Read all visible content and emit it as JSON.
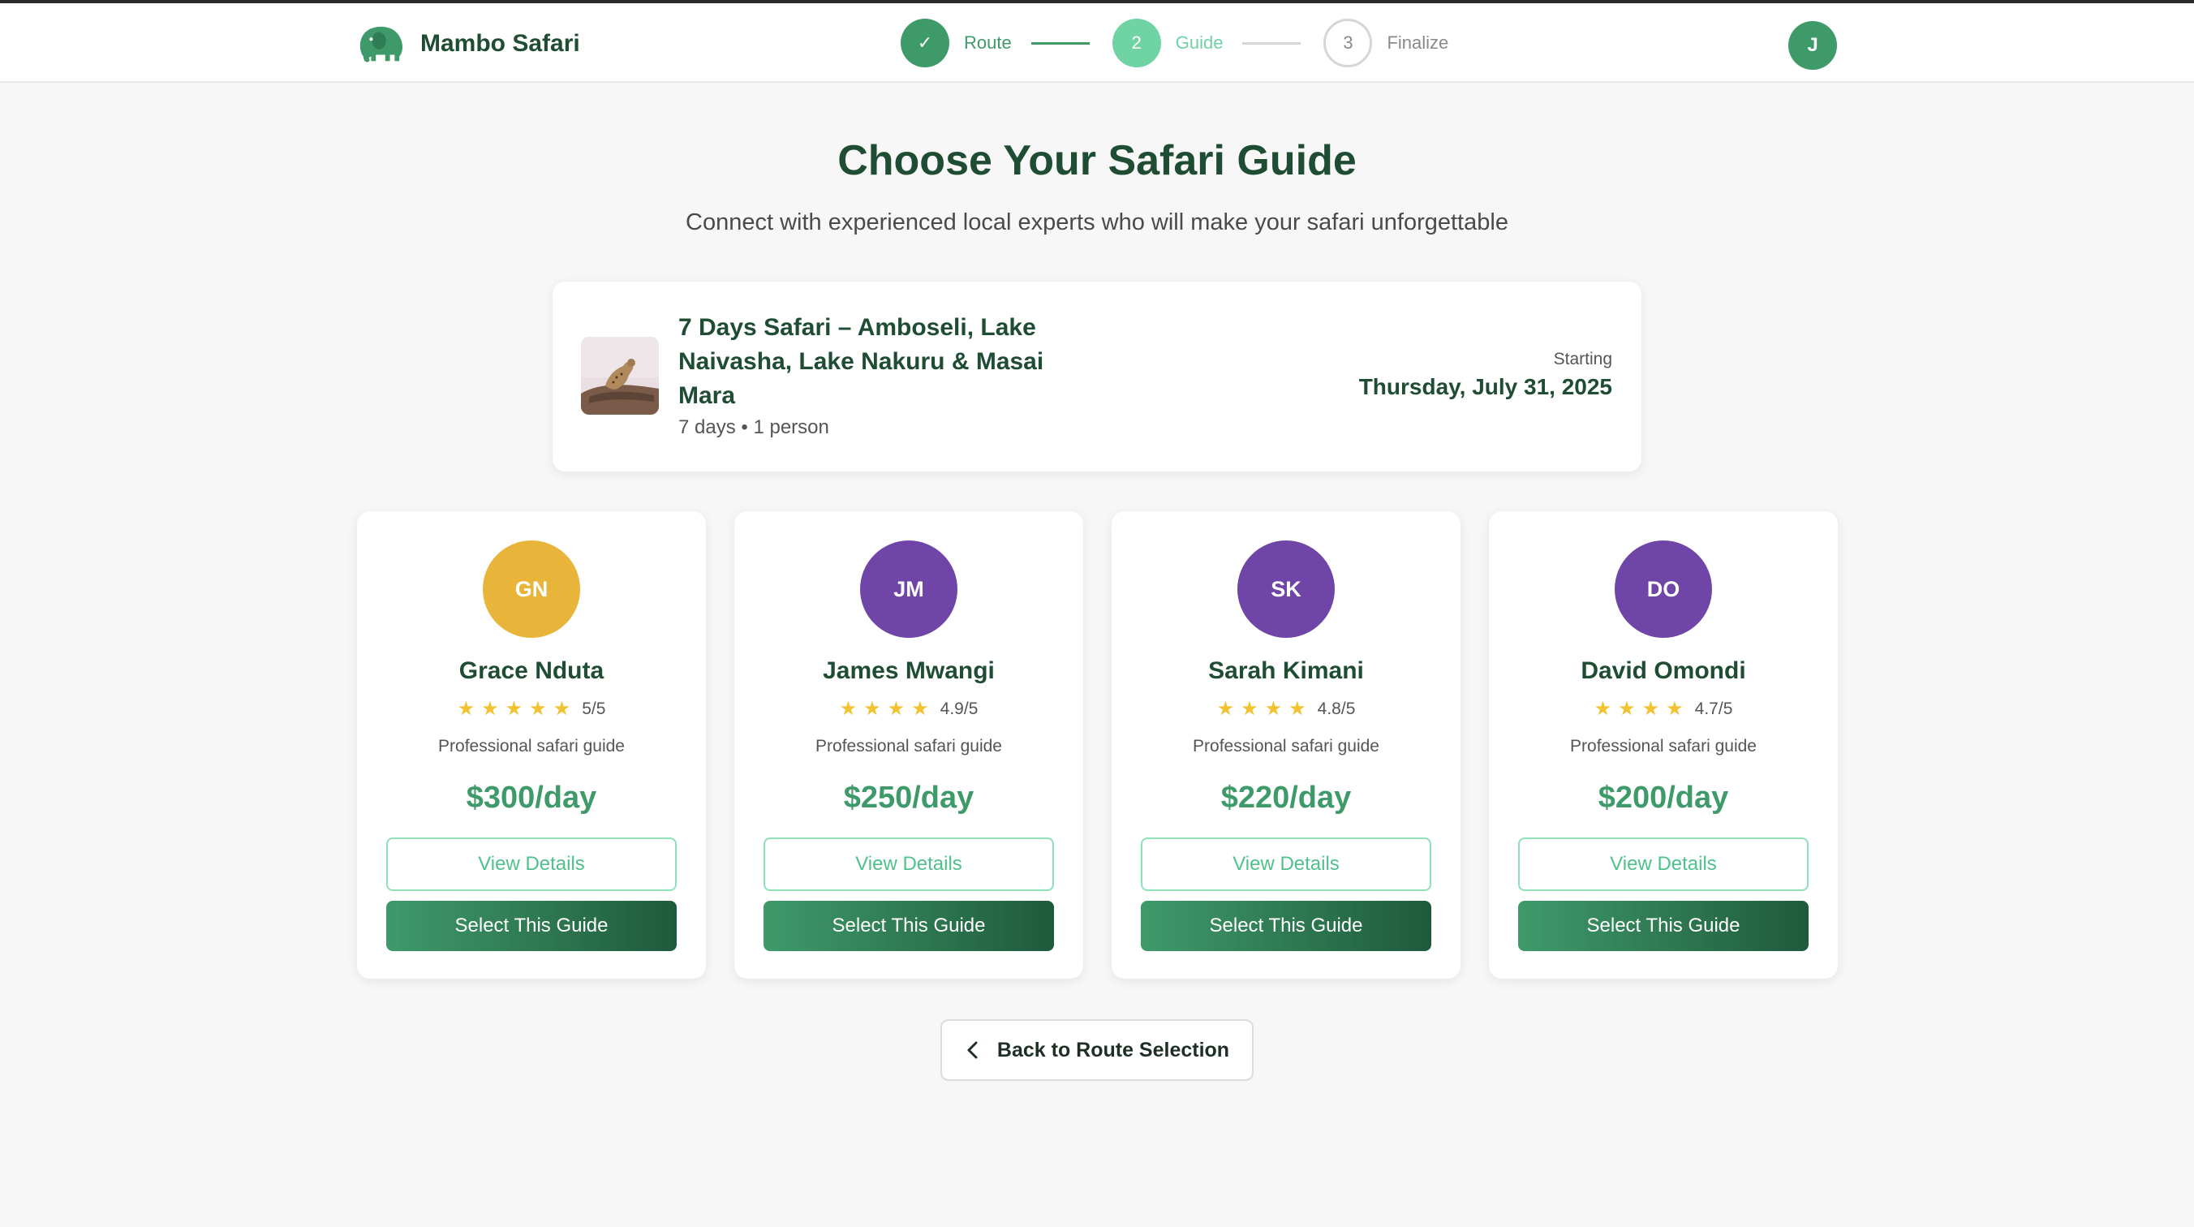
{
  "brand": {
    "name": "Mambo Safari",
    "color": "#3f9a6a",
    "logo_icon": "elephant-icon"
  },
  "stepper": [
    {
      "number": "1",
      "label": "Route",
      "state": "done",
      "glyph": "✓"
    },
    {
      "number": "2",
      "label": "Guide",
      "state": "active"
    },
    {
      "number": "3",
      "label": "Finalize",
      "state": "todo"
    }
  ],
  "user": {
    "initial": "J"
  },
  "page": {
    "title": "Choose Your Safari Guide",
    "subtitle": "Connect with experienced local experts who will make your safari unforgettable"
  },
  "trip": {
    "title": "7 Days Safari – Amboseli, Lake Naivasha, Lake Nakuru & Masai Mara",
    "meta": "7 days • 1 person",
    "start_label": "Starting",
    "start_date": "Thursday, July 31, 2025"
  },
  "guides": [
    {
      "initials": "GN",
      "name": "Grace Nduta",
      "rating": "5/5",
      "stars": 5,
      "description": "Professional safari guide",
      "price": "$300/day",
      "avatar_color": "#e8b53a",
      "details_label": "View Details",
      "select_label": "Select This Guide"
    },
    {
      "initials": "JM",
      "name": "James Mwangi",
      "rating": "4.9/5",
      "stars": 4,
      "description": "Professional safari guide",
      "price": "$250/day",
      "avatar_color": "#6f45a8",
      "details_label": "View Details",
      "select_label": "Select This Guide"
    },
    {
      "initials": "SK",
      "name": "Sarah Kimani",
      "rating": "4.8/5",
      "stars": 4,
      "description": "Professional safari guide",
      "price": "$220/day",
      "avatar_color": "#6f45a8",
      "details_label": "View Details",
      "select_label": "Select This Guide"
    },
    {
      "initials": "DO",
      "name": "David Omondi",
      "rating": "4.7/5",
      "stars": 4,
      "description": "Professional safari guide",
      "price": "$200/day",
      "avatar_color": "#6f45a8",
      "details_label": "View Details",
      "select_label": "Select This Guide"
    }
  ],
  "back_button": {
    "label": "Back to Route Selection",
    "icon": "chevron-left-icon"
  }
}
